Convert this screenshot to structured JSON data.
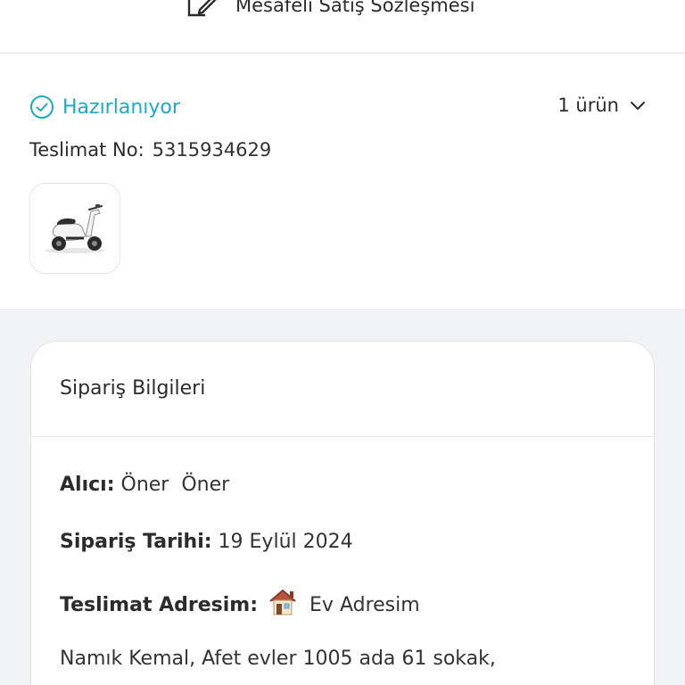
{
  "contract": {
    "label": "Mesafeli Satış Sözleşmesi",
    "icon": "edit-document-icon"
  },
  "shipment": {
    "status": "Hazırlanıyor",
    "status_color": "#1ba9c4",
    "product_count": "1 ürün",
    "delivery_label": "Teslimat No:",
    "delivery_number": "5315934629",
    "product_image": "scooter-image"
  },
  "order_info": {
    "title": "Sipariş Bilgileri",
    "recipient_label": "Alıcı:",
    "recipient_value": "Öner  Öner",
    "date_label": "Sipariş Tarihi:",
    "date_value": "19 Eylül 2024",
    "address_label": "Teslimat Adresim:",
    "address_icon": "house-icon",
    "address_name": "Ev Adresim",
    "address_line": "Namık Kemal, Afet evler 1005 ada 61 sokak,"
  }
}
